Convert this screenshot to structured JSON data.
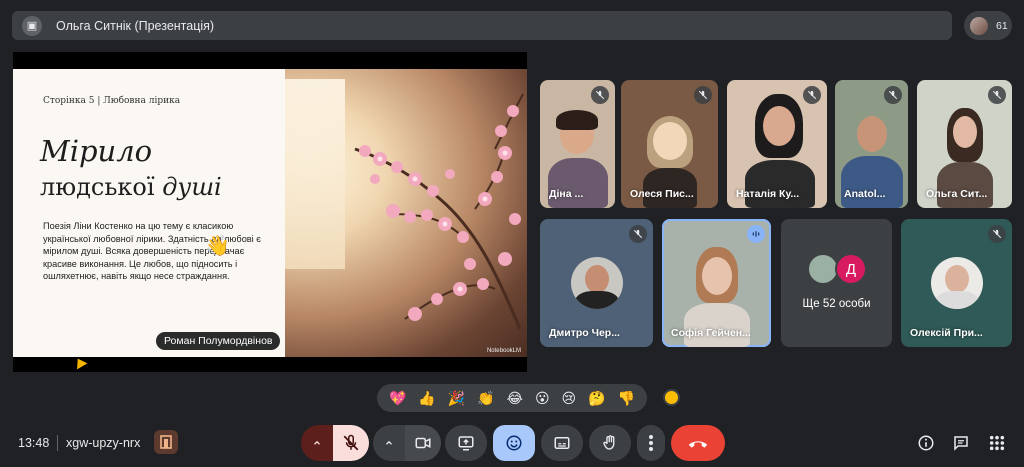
{
  "meeting": {
    "presenter_title": "Ольга Ситнік (Презентація)",
    "participant_count": "61",
    "time": "13:48",
    "code": "xgw-upzy-nrx"
  },
  "slide": {
    "breadcrumb": "Сторінка 5 | Любовна лірика",
    "heading_line1": "Мірило",
    "heading_line2_a": "людської ",
    "heading_line2_b": "душі",
    "body": "Поезія Ліни Костенко на цю тему є класикою української любовної лірики. Здатність до любові є мірилом душі. Всяка довершеність передбачає красиве виконання. Це любов, що підносить і ошляхетнює, навіть якщо несе страждання.",
    "brand": "NotebookLM",
    "raised_hand_name": "Роман Полумордвінов"
  },
  "tiles": [
    {
      "name": "Діна ..."
    },
    {
      "name": "Олеся Пис..."
    },
    {
      "name": "Наталія Ку..."
    },
    {
      "name": "Anatol..."
    },
    {
      "name": "Ольга Сит..."
    },
    {
      "name": "Дмитро Чер..."
    },
    {
      "name": "Софія Гейчен..."
    },
    {
      "name": "Ще 52 особи",
      "avatar_letter": "Д"
    },
    {
      "name": "Олексій При..."
    }
  ],
  "reactions": [
    "💖",
    "👍",
    "🎉",
    "👏",
    "😂",
    "😮",
    "😢",
    "🤔",
    "👎"
  ],
  "icons": {
    "present": "present-to-all-icon",
    "mic": "mic-off-icon",
    "camera": "videocam-icon",
    "share": "present-screen-icon",
    "emoji": "emoji-icon",
    "captions": "captions-icon",
    "hand": "raise-hand-icon",
    "more": "more-vert-icon",
    "leave": "call-end-icon",
    "info": "info-icon",
    "chat": "chat-icon",
    "activities": "apps-icon"
  },
  "colors": {
    "bg": "#202124",
    "leave": "#ea4335",
    "mic_off": "#f9dedc",
    "emoji_active": "#a8c7fa",
    "accent": "#8ab4f8"
  }
}
